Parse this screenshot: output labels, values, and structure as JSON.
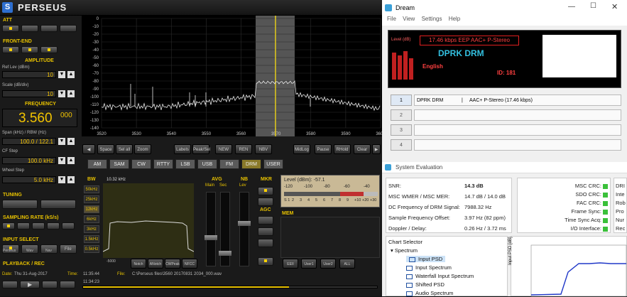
{
  "perseus": {
    "title": "PERSEUS",
    "labels": {
      "att": "ATT",
      "frontend": "FRONT-END",
      "amplitude": "AMPLITUDE",
      "reflev": "Ref Lev (dBm)",
      "scale": "Scale (dB/div)",
      "frequency": "FREQUENCY",
      "span": "Span (kHz) / RBW (Hz)",
      "cfstep": "CF Step",
      "wheelstep": "Wheel Step",
      "tuning": "TUNING",
      "sampling": "SAMPLING RATE (kS/s)",
      "input": "INPUT SELECT",
      "playback": "PLAYBACK / REC"
    },
    "values": {
      "reflev": "10",
      "scale": "10",
      "freq_main": "3.560",
      "freq_frac": "000",
      "span": "100.0 / 122.1",
      "cfstep": "100.0 kHz",
      "wheelstep": "5.0 kHz"
    },
    "input_buttons": [
      "Perseus",
      "Wav",
      "Nav",
      "File"
    ],
    "spectrum_ylabels": [
      "0",
      "-10",
      "-20",
      "-30",
      "-40",
      "-50",
      "-60",
      "-70",
      "-80",
      "-90",
      "-100",
      "-110",
      "-120",
      "-130",
      "-140"
    ],
    "spectrum_xlabels": [
      "3520",
      "3530",
      "3540",
      "3550",
      "3560",
      "3570",
      "3580",
      "3590",
      "3600"
    ],
    "strip_buttons": [
      "Space",
      "Sel all",
      "Zoom",
      "Labels",
      "Peak/Sel",
      "NEW",
      "REN",
      "NBV",
      "MidLog",
      "Pause",
      "RHold",
      "Clear"
    ],
    "modes": [
      "AM",
      "SAM",
      "CW",
      "RTTY",
      "LSB",
      "USB",
      "FM",
      "DRM",
      "USER"
    ],
    "bw_label": "BW",
    "bw_values": [
      "50kHz",
      "25kHz",
      "12kHz",
      "6kHz",
      "3kHz",
      "1.5kHz",
      "0.5kHz"
    ],
    "wf_freq": "10.32 kHz",
    "wf_ticks": [
      "-5000",
      "0",
      "5000"
    ],
    "avg_label": "AVG",
    "main_label": "Main",
    "sec_label": "Sec",
    "nb_label": "NB",
    "lev_label": "Lev",
    "mkr_label": "MKR",
    "agc_label": "AGC",
    "mem_label": "MEM",
    "level": {
      "text": "Level (dBm): -57.1",
      "scale_top": [
        "-120",
        "-100",
        "-80",
        "-60",
        "-40"
      ],
      "scale_bot": [
        "S 1",
        "2",
        "3",
        "4",
        "5",
        "6",
        "7",
        "8",
        "9",
        "+10",
        "+20",
        "+30"
      ]
    },
    "bottom_buttons": [
      "Notch",
      "ANotch",
      "CWPeak",
      "NFCC",
      "EEII",
      "User1",
      "User2",
      "ALL"
    ],
    "date": "Thu 31-Aug-2017",
    "time": "11:35:44",
    "time2": "11:34:23",
    "file": "C:\\Perseus files\\3560 20170831 2034_000.wav"
  },
  "dream": {
    "title": "Dream",
    "menu": [
      "File",
      "View",
      "Settings",
      "Help"
    ],
    "display": {
      "bitrate": "17.46 kbps EEP AAC+ P-Stereo",
      "level": "Level (dB)",
      "station": "DPRK DRM",
      "language": "English",
      "id": "ID: 181"
    },
    "services": [
      {
        "num": "1",
        "label": "DPRK DRM",
        "info": "AAC+ P-Stereo (17.46 kbps)"
      },
      {
        "num": "2",
        "label": "",
        "info": ""
      },
      {
        "num": "3",
        "label": "",
        "info": ""
      },
      {
        "num": "4",
        "label": "",
        "info": ""
      }
    ],
    "sysval": {
      "title": "System Evaluation",
      "rows": [
        {
          "k": "SNR:",
          "v": "14.3 dB"
        },
        {
          "k": "MSC WMER / MSC MER:",
          "v": "14.7 dB / 14.0 dB"
        },
        {
          "k": "DC Frequency of DRM Signal:",
          "v": "7988.32 Hz"
        },
        {
          "k": "Sample Frequency Offset:",
          "v": "3.97 Hz (82 ppm)"
        },
        {
          "k": "Doppler / Delay:",
          "v": "0.26 Hz / 3.72 ms"
        }
      ],
      "status": [
        "MSC CRC:",
        "SDO CRC:",
        "FAC CRC:",
        "Frame Sync:",
        "Time Sync Acq:",
        "I/O Interface:"
      ],
      "status_right": [
        "DRI",
        "Inte",
        "Rob",
        "Pro",
        "Nur",
        "Rec"
      ],
      "chart_selector": "Chart Selector",
      "tree": [
        "Spectrum",
        "Input PSD",
        "Input Spectrum",
        "Waterfall Input Spectrum",
        "Shifted PSD",
        "Audio Spectrum"
      ],
      "plot_ylabel": "Input PSD [dB]"
    }
  }
}
